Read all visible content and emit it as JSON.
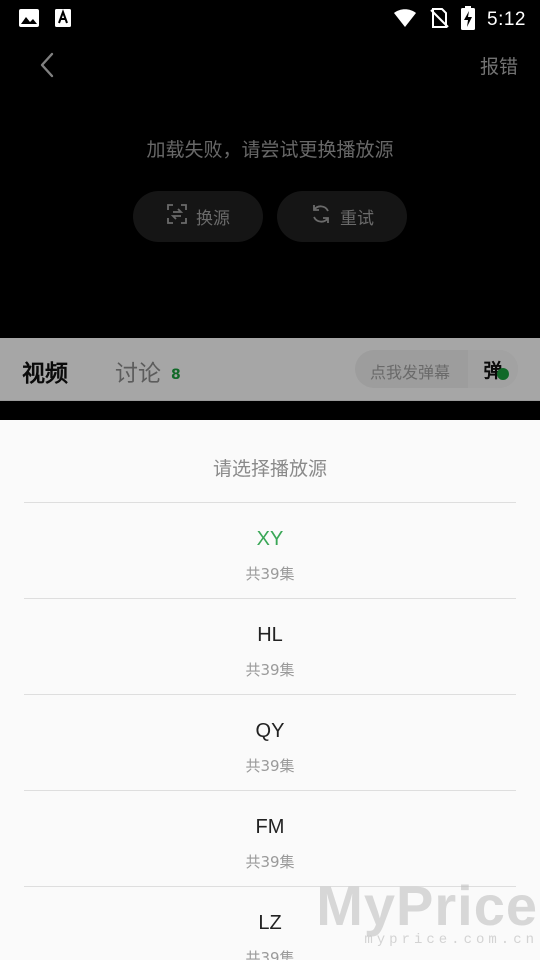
{
  "status_bar": {
    "time": "5:12",
    "icons": [
      "image-icon",
      "text-a-icon",
      "wifi-icon",
      "no-sim-icon",
      "battery-charging-icon"
    ]
  },
  "player": {
    "report_label": "报错",
    "error_message": "加载失败，请尝试更换播放源",
    "switch_source_label": "换源",
    "retry_label": "重试"
  },
  "tabs": {
    "video_label": "视频",
    "discuss_label": "讨论",
    "discuss_count": "8",
    "danmaku_placeholder": "点我发弹幕",
    "danmaku_toggle_label": "弹"
  },
  "sheet": {
    "title": "请选择播放源",
    "sources": [
      {
        "name": "XY",
        "count": "共39集",
        "selected": true
      },
      {
        "name": "HL",
        "count": "共39集",
        "selected": false
      },
      {
        "name": "QY",
        "count": "共39集",
        "selected": false
      },
      {
        "name": "FM",
        "count": "共39集",
        "selected": false
      },
      {
        "name": "LZ",
        "count": "共39集",
        "selected": false
      }
    ]
  },
  "watermark": {
    "main": "MyPrice",
    "sub": "myprice.com.cn"
  },
  "colors": {
    "selected_source": "#3aa757",
    "discuss_count": "#1a9b3c"
  }
}
